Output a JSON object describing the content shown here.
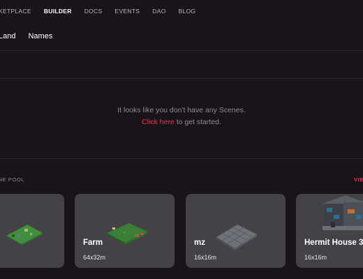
{
  "nav": {
    "items": [
      "KETPLACE",
      "BUILDER",
      "DOCS",
      "EVENTS",
      "DAO",
      "BLOG"
    ],
    "active": "BUILDER"
  },
  "subtabs": [
    "Land",
    "Names"
  ],
  "empty_state": {
    "message": "It looks like you don't have any Scenes.",
    "link_text": "Click here",
    "suffix": " to get started."
  },
  "scene_pool": {
    "title": "ENE POOL",
    "view_more": "VIEW MORE",
    "cards": [
      {
        "title": "",
        "size": "",
        "icon": "grass-land-thumbnail"
      },
      {
        "title": "Farm",
        "size": "64x32m",
        "icon": "farm-thumbnail"
      },
      {
        "title": "mz",
        "size": "16x16m",
        "icon": "stone-tile-thumbnail"
      },
      {
        "title": "Hermit House 3",
        "size": "16x16m",
        "icon": "house-thumbnail"
      }
    ]
  },
  "colors": {
    "background": "#18141a",
    "card": "#444147",
    "accent": "#ff2d55",
    "muted_text": "#8f8b93"
  }
}
